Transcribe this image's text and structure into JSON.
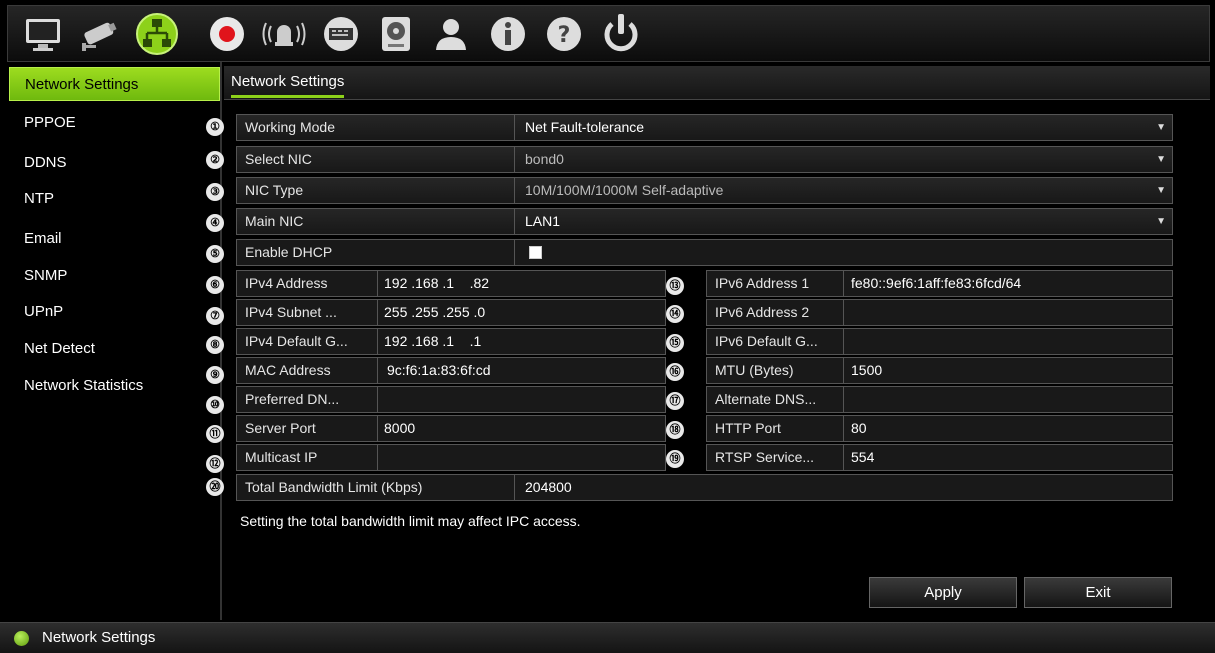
{
  "toolbar": {
    "icons": [
      "monitor-icon",
      "camera-icon",
      "network-icon",
      "record-icon",
      "alarm-icon",
      "devices-icon",
      "storage-icon",
      "user-icon",
      "info-icon",
      "help-icon",
      "power-icon"
    ],
    "active": "network-icon",
    "accent": "#8dd11a"
  },
  "sidebar": {
    "items": [
      {
        "label": "Network Settings",
        "active": true
      },
      {
        "label": "PPPOE"
      },
      {
        "label": "DDNS"
      },
      {
        "label": "NTP"
      },
      {
        "label": "Email"
      },
      {
        "label": "SNMP"
      },
      {
        "label": "UPnP"
      },
      {
        "label": "Net Detect"
      },
      {
        "label": "Network Statistics"
      }
    ]
  },
  "main": {
    "tab": "Network Settings",
    "numbers": [
      "①",
      "②",
      "③",
      "④",
      "⑤",
      "⑥",
      "⑦",
      "⑧",
      "⑨",
      "⑩",
      "⑪",
      "⑫",
      "⑬",
      "⑭",
      "⑮",
      "⑯",
      "⑰",
      "⑱",
      "⑲",
      "⑳"
    ],
    "working_mode": {
      "label": "Working Mode",
      "value": "Net Fault-tolerance"
    },
    "select_nic": {
      "label": "Select NIC",
      "value": "bond0"
    },
    "nic_type": {
      "label": "NIC Type",
      "value": "10M/100M/1000M Self-adaptive"
    },
    "main_nic": {
      "label": "Main NIC",
      "value": "LAN1"
    },
    "enable_dhcp": {
      "label": "Enable DHCP",
      "checked": false
    },
    "left_fields": [
      {
        "label": "IPv4 Address",
        "value": "192 .168 .1    .82"
      },
      {
        "label": "IPv4 Subnet ...",
        "value": "255 .255 .255 .0"
      },
      {
        "label": "IPv4 Default G...",
        "value": "192 .168 .1    .1"
      },
      {
        "label": "MAC Address",
        "value": "9c:f6:1a:83:6f:cd"
      },
      {
        "label": "Preferred DN...",
        "value": ""
      },
      {
        "label": "Server Port",
        "value": "8000"
      },
      {
        "label": "Multicast IP",
        "value": ""
      }
    ],
    "right_fields": [
      {
        "label": "IPv6 Address 1",
        "value": "fe80::9ef6:1aff:fe83:6fcd/64"
      },
      {
        "label": "IPv6 Address 2",
        "value": ""
      },
      {
        "label": "IPv6 Default G...",
        "value": ""
      },
      {
        "label": "MTU (Bytes)",
        "value": "1500"
      },
      {
        "label": "Alternate DNS...",
        "value": ""
      },
      {
        "label": "HTTP Port",
        "value": "80"
      },
      {
        "label": "RTSP Service...",
        "value": "554"
      }
    ],
    "bandwidth": {
      "label": "Total Bandwidth Limit (Kbps)",
      "value": "204800"
    },
    "hint": "Setting the total bandwidth limit may affect IPC access.",
    "apply_label": "Apply",
    "exit_label": "Exit"
  },
  "status_bar": {
    "text": "Network Settings"
  }
}
